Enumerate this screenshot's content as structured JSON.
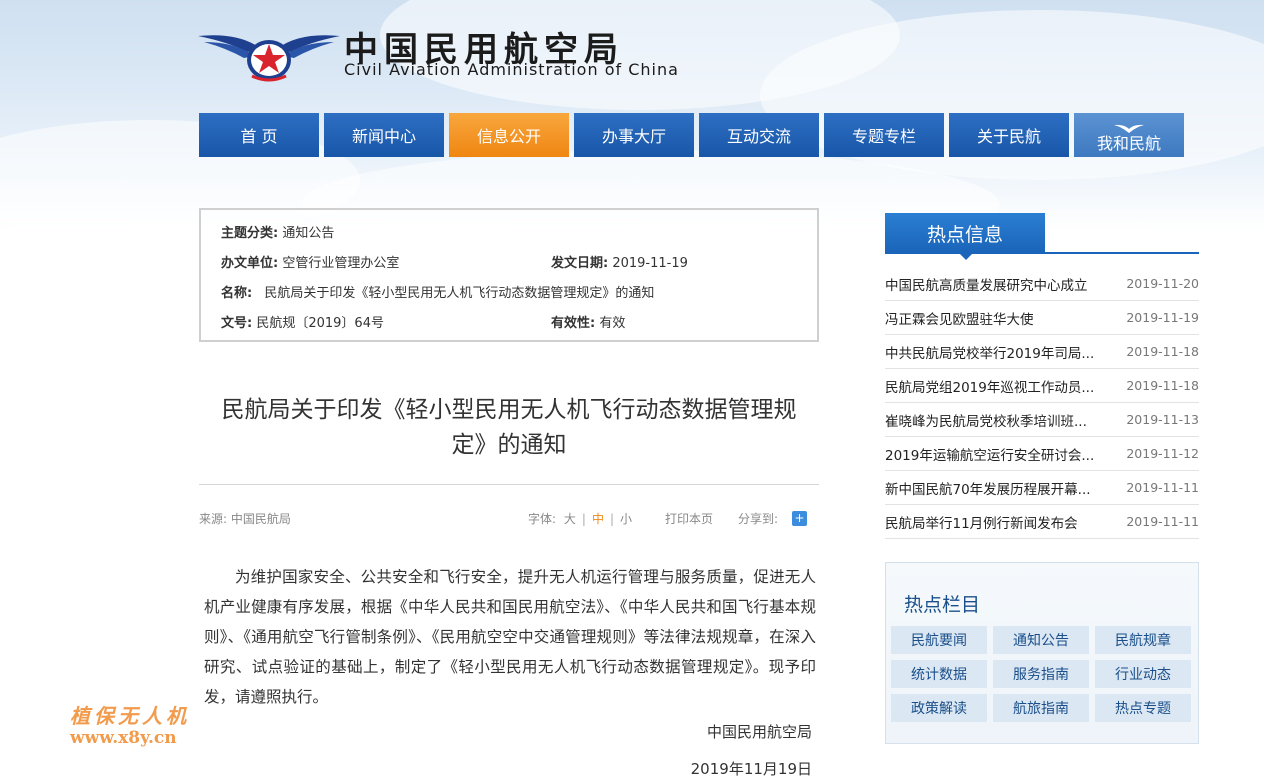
{
  "header": {
    "title_cn": "中国民用航空局",
    "title_en": "Civil Aviation Administration of China"
  },
  "nav": {
    "items": [
      {
        "label": "首 页"
      },
      {
        "label": "新闻中心"
      },
      {
        "label": "信息公开",
        "active": true
      },
      {
        "label": "办事大厅"
      },
      {
        "label": "互动交流"
      },
      {
        "label": "专题专栏"
      },
      {
        "label": "关于民航"
      },
      {
        "label": "我和民航"
      }
    ]
  },
  "meta": {
    "topic_label": "主题分类:",
    "topic_value": "通知公告",
    "unit_label": "办文单位:",
    "unit_value": "空管行业管理办公室",
    "date_label": "发文日期:",
    "date_value": "2019-11-19",
    "name_label": "名称:",
    "name_value": "民航局关于印发《轻小型民用无人机飞行动态数据管理规定》的通知",
    "docno_label": "文号:",
    "docno_value": "民航规〔2019〕64号",
    "validity_label": "有效性:",
    "validity_value": "有效"
  },
  "article": {
    "title_line1": "民航局关于印发《轻小型民用无人机飞行动态数据管理规",
    "title_line2": "定》的通知",
    "source": "来源: 中国民航局",
    "font_label": "字体:",
    "font_large": "大",
    "font_medium": "中",
    "font_small": "小",
    "print": "打印本页",
    "share": "分享到:",
    "body": "为维护国家安全、公共安全和飞行安全，提升无人机运行管理与服务质量，促进无人机产业健康有序发展，根据《中华人民共和国民用航空法》、《中华人民共和国飞行基本规则》、《通用航空飞行管制条例》、《民用航空空中交通管理规则》等法律法规规章，在深入研究、试点验证的基础上，制定了《轻小型民用无人机飞行动态数据管理规定》。现予印发，请遵照执行。",
    "signer": "中国民用航空局",
    "sign_date": "2019年11月19日"
  },
  "watermark": {
    "name": "植保无人机",
    "url": "www.x8y.cn"
  },
  "hot": {
    "heading": "热点信息",
    "items": [
      {
        "title": "中国民航高质量发展研究中心成立",
        "date": "2019-11-20"
      },
      {
        "title": "冯正霖会见欧盟驻华大使",
        "date": "2019-11-19"
      },
      {
        "title": "中共民航局党校举行2019年司局...",
        "date": "2019-11-18"
      },
      {
        "title": "民航局党组2019年巡视工作动员...",
        "date": "2019-11-18"
      },
      {
        "title": "崔晓峰为民航局党校秋季培训班...",
        "date": "2019-11-13"
      },
      {
        "title": "2019年运输航空运行安全研讨会...",
        "date": "2019-11-12"
      },
      {
        "title": "新中国民航70年发展历程展开幕...",
        "date": "2019-11-11"
      },
      {
        "title": "民航局举行11月例行新闻发布会",
        "date": "2019-11-11"
      }
    ]
  },
  "columns": {
    "heading": "热点栏目",
    "items": [
      "民航要闻",
      "通知公告",
      "民航规章",
      "统计数据",
      "服务指南",
      "行业动态",
      "政策解读",
      "航旅指南",
      "热点专题"
    ]
  }
}
